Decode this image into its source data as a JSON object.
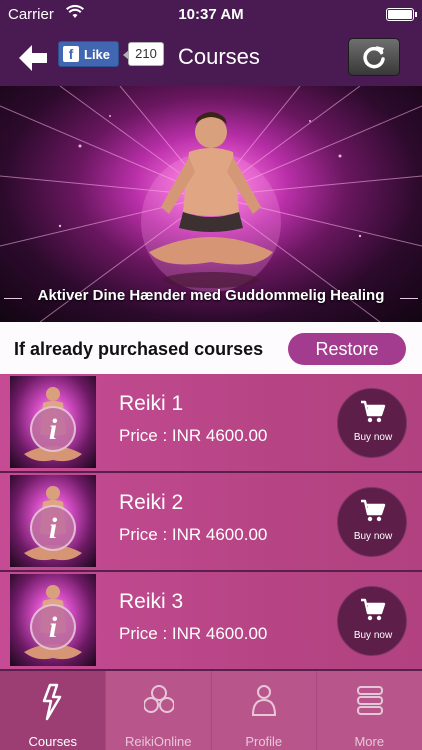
{
  "status_bar": {
    "carrier": "Carrier",
    "time": "10:37 AM"
  },
  "nav": {
    "title": "Courses",
    "fb_like_label": "Like",
    "fb_like_count": "210"
  },
  "banner": {
    "caption": "Aktiver Dine Hænder med Guddommelig Healing"
  },
  "restore": {
    "label": "If already purchased courses",
    "button": "Restore"
  },
  "courses": [
    {
      "name": "Reiki 1",
      "price": "Price : INR 4600.00",
      "buy_label": "Buy now"
    },
    {
      "name": "Reiki 2",
      "price": "Price : INR 4600.00",
      "buy_label": "Buy now"
    },
    {
      "name": "Reiki 3",
      "price": "Price : INR 4600.00",
      "buy_label": "Buy now"
    }
  ],
  "tabs": [
    {
      "label": "Courses",
      "icon": "lightning-hand-icon",
      "active": true
    },
    {
      "label": "ReikiOnline",
      "icon": "online-recycle-icon",
      "active": false
    },
    {
      "label": "Profile",
      "icon": "person-icon",
      "active": false
    },
    {
      "label": "More",
      "icon": "stack-icon",
      "active": false
    }
  ],
  "colors": {
    "nav_bg": "#4a1b52",
    "accent": "#a33c8f",
    "row_bg": "#c64b95",
    "tab_bg": "#b8568c"
  }
}
